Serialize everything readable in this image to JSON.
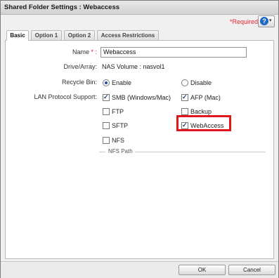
{
  "window": {
    "title": "Shared Folder Settings : Webaccess"
  },
  "header": {
    "required_note": "*Required",
    "help_icon": "question-circle-icon",
    "help_glyph": "?",
    "caret_glyph": "▾"
  },
  "tabs": [
    {
      "label": "Basic",
      "active": true
    },
    {
      "label": "Option 1",
      "active": false
    },
    {
      "label": "Option 2",
      "active": false
    },
    {
      "label": "Access Restrictions",
      "active": false
    }
  ],
  "form": {
    "name_label": "Name",
    "name_required_mark": " * :",
    "name_value": "Webaccess",
    "drive_label": "Drive/Array:",
    "drive_value": "NAS Volume : nasvol1",
    "recycle_label": "Recycle Bin:",
    "recycle_options": [
      {
        "label": "Enable",
        "selected": true
      },
      {
        "label": "Disable",
        "selected": false
      }
    ],
    "lan_label": "LAN Protocol Support:",
    "protocols": [
      {
        "label": "SMB (Windows/Mac)",
        "checked": true
      },
      {
        "label": "AFP (Mac)",
        "checked": true
      },
      {
        "label": "FTP",
        "checked": false
      },
      {
        "label": "Backup",
        "checked": false
      },
      {
        "label": "SFTP",
        "checked": false
      },
      {
        "label": "WebAccess",
        "checked": true
      },
      {
        "label": "NFS",
        "checked": false
      }
    ],
    "nfs_path_label": "NFS Path"
  },
  "footer": {
    "ok_label": "OK",
    "cancel_label": "Cancel"
  },
  "colors": {
    "required": "#e0242c",
    "highlight": "#e3161d",
    "help_blue": "#1f68c4"
  }
}
